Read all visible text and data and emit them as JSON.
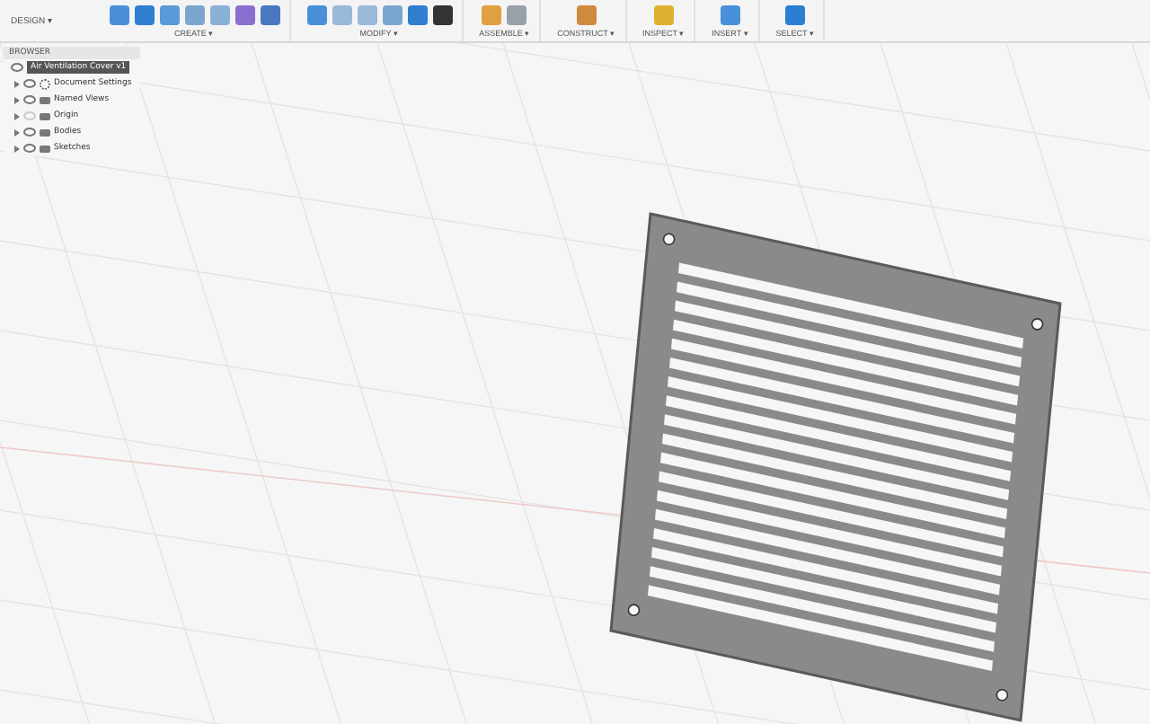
{
  "workspace": {
    "label": "DESIGN ▾"
  },
  "toolbar": [
    {
      "label": "CREATE ▾",
      "kind": "create"
    },
    {
      "label": "MODIFY ▾",
      "kind": "modify"
    },
    {
      "label": "ASSEMBLE ▾",
      "kind": "assemble"
    },
    {
      "label": "CONSTRUCT ▾",
      "kind": "construct"
    },
    {
      "label": "INSPECT ▾",
      "kind": "inspect"
    },
    {
      "label": "INSERT ▾",
      "kind": "insert"
    },
    {
      "label": "SELECT ▾",
      "kind": "select"
    }
  ],
  "browser": {
    "title": "BROWSER",
    "root": {
      "name": "Air Ventilation Cover v1",
      "visible": true,
      "children": [
        {
          "name": "Document Settings",
          "kind": "settings",
          "visible": true
        },
        {
          "name": "Named Views",
          "kind": "folder",
          "visible": true
        },
        {
          "name": "Origin",
          "kind": "folder",
          "visible": false
        },
        {
          "name": "Bodies",
          "kind": "folder",
          "visible": true
        },
        {
          "name": "Sketches",
          "kind": "folder",
          "visible": true
        }
      ]
    }
  }
}
